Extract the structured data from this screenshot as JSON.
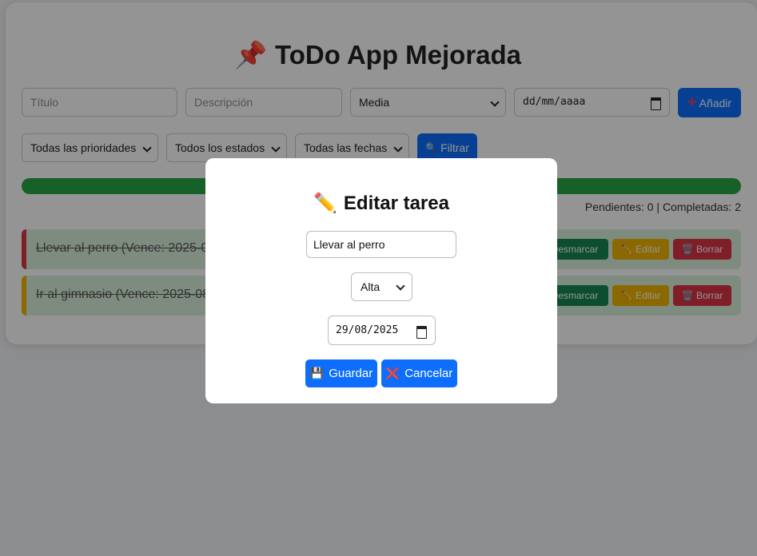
{
  "app": {
    "title_emoji": "📌",
    "title": "ToDo App Mejorada"
  },
  "form": {
    "title_placeholder": "Título",
    "description_placeholder": "Descripción",
    "priority_value": "Media",
    "date_placeholder": "dd/mm/aaaa",
    "add_icon": "+",
    "add_label": "Añadir"
  },
  "filters": {
    "priority": "Todas las prioridades",
    "status": "Todos los estados",
    "date": "Todas las fechas",
    "filter_icon": "🔍",
    "filter_label": "Filtrar"
  },
  "progress": {
    "completed_fraction": 1.0,
    "color": "#28a745"
  },
  "counters": "Pendientes: 0 | Completadas: 2",
  "tasks": [
    {
      "text": "Llevar al perro (Vence: 2025-08-29)",
      "priority_color": "#dc3545",
      "unmark_label": "Desmarcar",
      "edit_label": "✏️ Editar",
      "delete_label": "🗑️ Borrar"
    },
    {
      "text": "Ir al gimnasio (Vence: 2025-08-30)",
      "priority_color": "#f0b400",
      "unmark_label": "Desmarcar",
      "edit_label": "✏️ Editar",
      "delete_label": "🗑️ Borrar"
    }
  ],
  "modal": {
    "title_emoji": "✏️",
    "title": "Editar tarea",
    "task_value": "Llevar al perro",
    "priority_value": "Alta",
    "date_value": "29/08/2025",
    "save_icon": "💾",
    "save_label": "Guardar",
    "cancel_icon": "❌",
    "cancel_label": "Cancelar"
  }
}
